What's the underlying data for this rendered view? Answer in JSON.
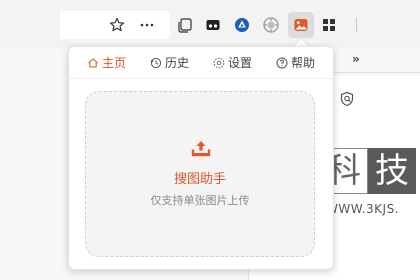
{
  "popup": {
    "nav": [
      {
        "label": "主页",
        "icon": "home-icon",
        "active": true
      },
      {
        "label": "历史",
        "icon": "history-icon",
        "active": false
      },
      {
        "label": "设置",
        "icon": "settings-icon",
        "active": false
      },
      {
        "label": "帮助",
        "icon": "help-icon",
        "active": false
      }
    ],
    "dropzone": {
      "title": "搜图助手",
      "subtitle": "仅支持单张图片上传"
    }
  },
  "toolbar": {
    "icons": [
      "favorite-star-icon",
      "more-icon",
      "collections-icon",
      "extension-icon",
      "shield-extension-icon",
      "circle-extension-icon",
      "image-search-extension-icon",
      "apps-icon"
    ],
    "overflow": "»"
  },
  "watermark": {
    "chars": [
      "科",
      "技"
    ],
    "url": "WWW.3KJS."
  },
  "colors": {
    "accent": "#e0582b",
    "popup_bg": "#ffffff",
    "dropzone_bg": "#f4f4f4"
  }
}
